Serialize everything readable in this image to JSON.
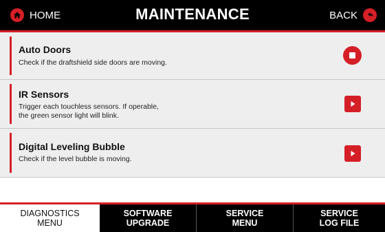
{
  "header": {
    "home_label": "HOME",
    "title": "MAINTENANCE",
    "back_label": "BACK",
    "home_icon": "home-icon",
    "back_icon": "back-arrow-icon"
  },
  "items": [
    {
      "title": "Auto Doors",
      "description": "Check if the draftshield side doors are moving.",
      "action": "stop",
      "action_icon": "stop-icon"
    },
    {
      "title": "IR Sensors",
      "description": "Trigger each touchless sensors. If operable,\nthe green sensor light will blink.",
      "action": "play",
      "action_icon": "play-icon"
    },
    {
      "title": "Digital Leveling Bubble",
      "description": "Check if the level bubble is moving.",
      "action": "play",
      "action_icon": "play-icon"
    }
  ],
  "tabs": [
    {
      "line1": "DIAGNOSTICS",
      "line2": "MENU",
      "active": true
    },
    {
      "line1": "SOFTWARE",
      "line2": "UPGRADE",
      "active": false
    },
    {
      "line1": "SERVICE",
      "line2": "MENU",
      "active": false
    },
    {
      "line1": "SERVICE",
      "line2": "LOG FILE",
      "active": false
    }
  ],
  "colors": {
    "accent": "#d51f27",
    "header_bg": "#000000",
    "row_bg": "#eeeeee"
  }
}
